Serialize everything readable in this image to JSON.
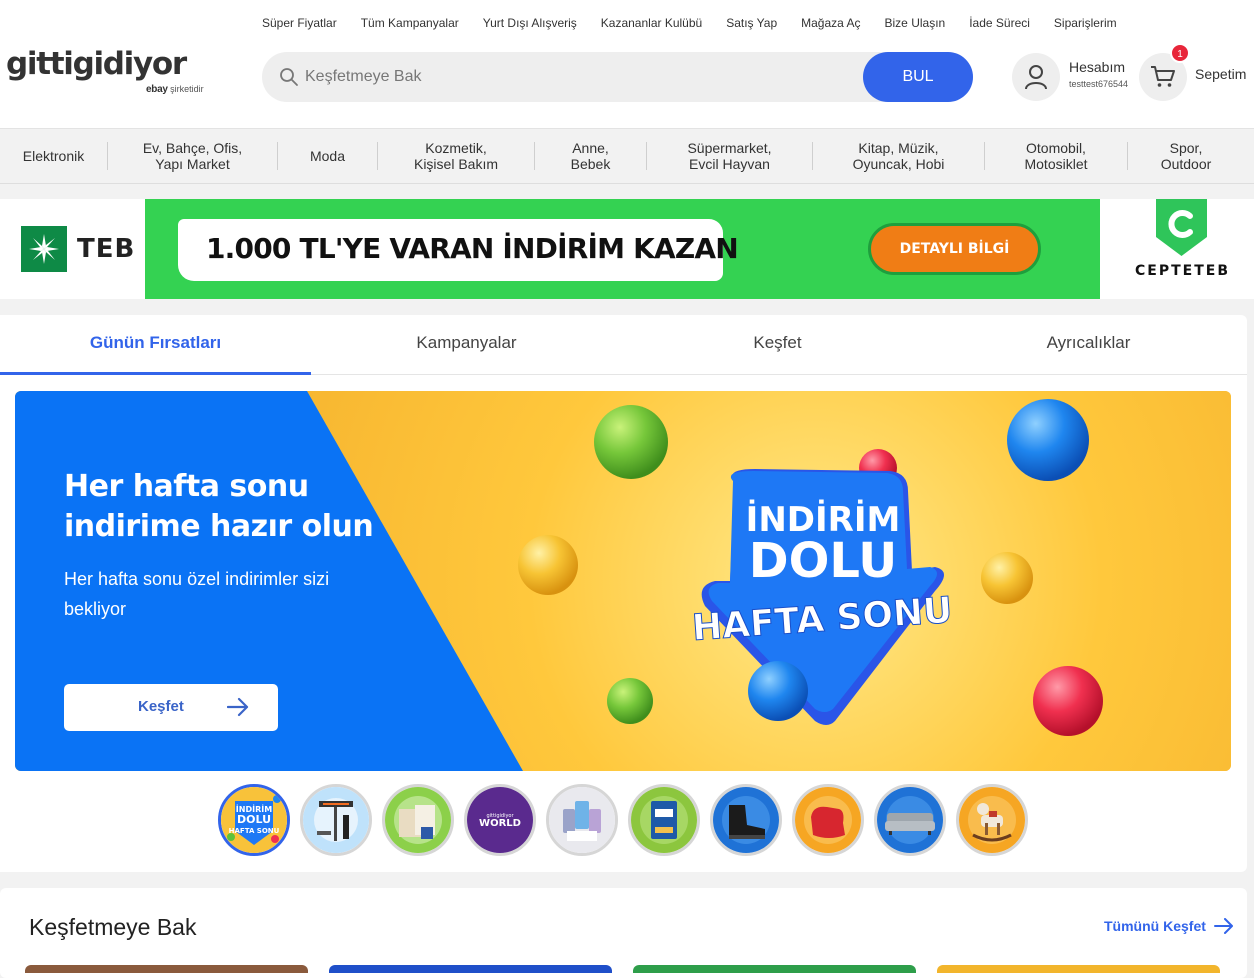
{
  "top_links": [
    "Süper Fiyatlar",
    "Tüm Kampanyalar",
    "Yurt Dışı Alışveriş",
    "Kazananlar Kulübü",
    "Satış Yap",
    "Mağaza Aç",
    "Bize Ulaşın",
    "İade Süreci",
    "Siparişlerim"
  ],
  "logo": {
    "word": "gittigidiyor",
    "ebay": "ebay",
    "tagline": "şirketidir"
  },
  "search": {
    "placeholder": "Keşfetmeye Bak",
    "button": "BUL"
  },
  "account": {
    "label": "Hesabım",
    "username": "testtest676544"
  },
  "cart": {
    "label": "Sepetim",
    "count": "1"
  },
  "categories": [
    {
      "line1": "Elektronik",
      "line2": ""
    },
    {
      "line1": "Ev, Bahçe, Ofis,",
      "line2": "Yapı Market"
    },
    {
      "line1": "Moda",
      "line2": ""
    },
    {
      "line1": "Kozmetik,",
      "line2": "Kişisel Bakım"
    },
    {
      "line1": "Anne,",
      "line2": "Bebek"
    },
    {
      "line1": "Süpermarket,",
      "line2": "Evcil Hayvan"
    },
    {
      "line1": "Kitap, Müzik,",
      "line2": "Oyuncak, Hobi"
    },
    {
      "line1": "Otomobil,",
      "line2": "Motosiklet"
    },
    {
      "line1": "Spor,",
      "line2": "Outdoor"
    }
  ],
  "ad_banner": {
    "brand": "TEB",
    "headline": "1.000 TL'YE VARAN İNDİRİM KAZAN",
    "cta": "DETAYLI BİLGİ",
    "app_brand": "CEPTETEB"
  },
  "tabs": [
    {
      "label": "Günün Fırsatları",
      "active": true
    },
    {
      "label": "Kampanyalar",
      "active": false
    },
    {
      "label": "Keşfet",
      "active": false
    },
    {
      "label": "Ayrıcalıklar",
      "active": false
    }
  ],
  "hero": {
    "title": "Her hafta sonu indirime hazır olun",
    "subtitle": "Her hafta sonu özel indirimler sizi bekliyor",
    "button": "Keşfet",
    "badge_line1": "İNDİRİM",
    "badge_line2": "DOLU",
    "badge_line3": "HAFTA SONU"
  },
  "carousel_thumbs": [
    {
      "icon": "indirim-dolu-hafta-sonu-thumb",
      "text_line1": "İNDİRİM",
      "text_line2": "DOLU",
      "text_line3": "HAFTA SONU"
    },
    {
      "icon": "heater-thumb"
    },
    {
      "icon": "insulation-tools-thumb"
    },
    {
      "icon": "world-card-thumb",
      "text_line1": "gittigidiyor",
      "text_line2": "WORLD"
    },
    {
      "icon": "phones-thumb"
    },
    {
      "icon": "baby-formula-thumb"
    },
    {
      "icon": "boots-thumb"
    },
    {
      "icon": "bean-bag-thumb"
    },
    {
      "icon": "sofa-thumb"
    },
    {
      "icon": "rocking-horse-thumb"
    }
  ],
  "section2": {
    "title": "Keşfetmeye Bak",
    "link": "Tümünü Keşfet"
  },
  "colors": {
    "accent": "#3264ea",
    "hero_blue": "#0a73f5",
    "hero_yellow": "#f9b832",
    "teb_green": "#34d252",
    "cta_orange": "#f07d15",
    "badge_red": "#e8263a"
  }
}
